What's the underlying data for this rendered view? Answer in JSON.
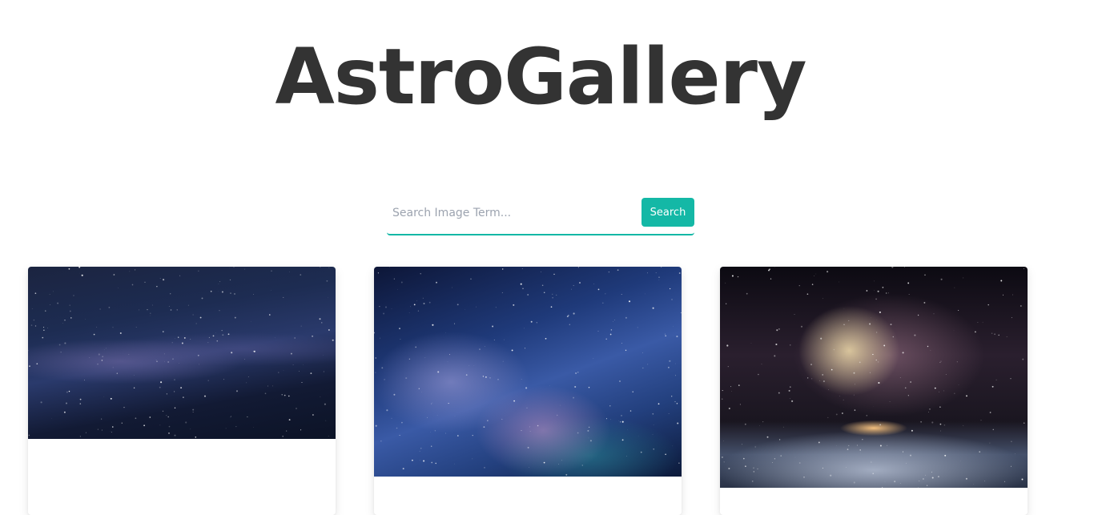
{
  "header": {
    "title": "AstroGallery"
  },
  "search": {
    "placeholder": "Search Image Term...",
    "value": "",
    "button_label": "Search"
  },
  "gallery": {
    "images": [
      {
        "alt": "Milky Way starfield"
      },
      {
        "alt": "Blue nebula starry sky"
      },
      {
        "alt": "Galaxy over planet horizon"
      }
    ]
  },
  "colors": {
    "accent": "#14b8a6",
    "title_text": "#333333"
  }
}
